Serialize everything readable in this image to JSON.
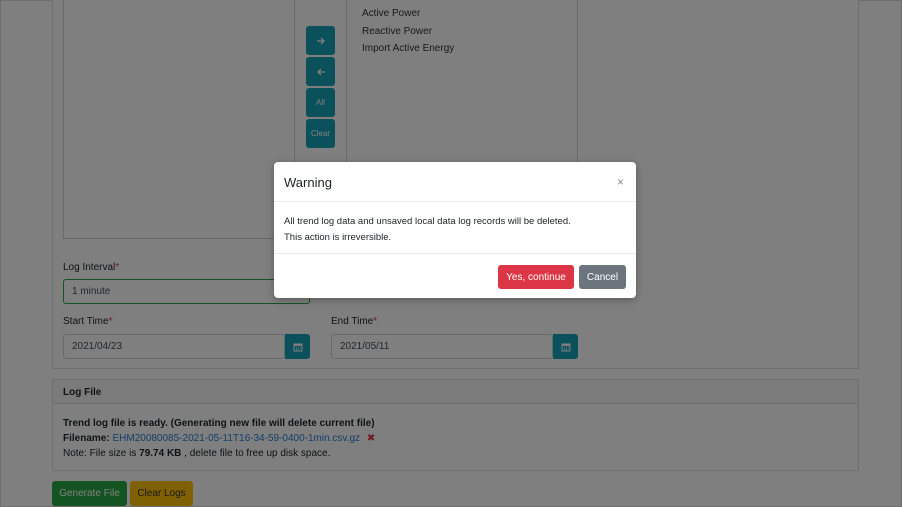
{
  "channels": {
    "selected_items": [
      "Active Power",
      "Reactive Power",
      "Import Active Energy"
    ],
    "move_right_icon": "arrow-right-icon",
    "move_left_icon": "arrow-left-icon",
    "all_label": "All",
    "clear_label": "Clear"
  },
  "log_interval": {
    "label": "Log Interval",
    "required_mark": "*",
    "value": "1 minute"
  },
  "start_time": {
    "label": "Start Time",
    "required_mark": "*",
    "value": "2021/04/23"
  },
  "end_time": {
    "label": "End Time",
    "required_mark": "*",
    "value": "2021/05/11"
  },
  "log_file": {
    "header": "Log File",
    "ready_text": "Trend log file is ready. (Generating new file will delete current file)",
    "filename_label": "Filename:",
    "filename": "EHM20080085-2021-05-11T16-34-59-0400-1min.csv.gz",
    "note_prefix": "Note: File size is",
    "file_size": "79.74 KB",
    "note_suffix": ", delete file to free up disk space."
  },
  "actions": {
    "generate_label": "Generate File",
    "clear_logs_label": "Clear Logs"
  },
  "modal": {
    "title": "Warning",
    "close_glyph": "×",
    "body_line1": "All trend log data and unsaved local data log records will be deleted.",
    "body_line2": "This action is irreversible.",
    "confirm_label": "Yes, continue",
    "cancel_label": "Cancel"
  },
  "colors": {
    "teal": "#17a2b8",
    "danger": "#dc3545",
    "secondary": "#6c757d",
    "success": "#28a745",
    "warning": "#ffc107"
  }
}
